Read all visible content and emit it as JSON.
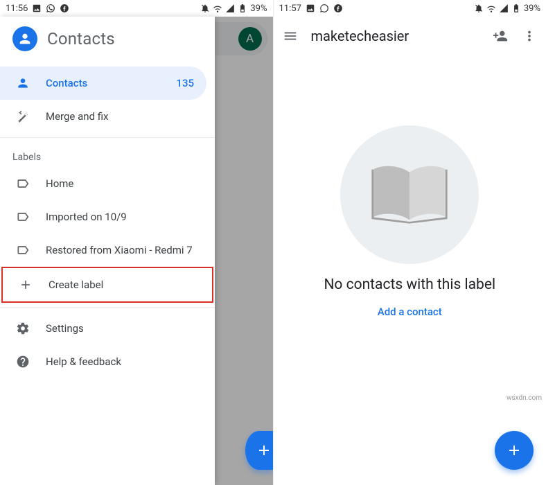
{
  "left": {
    "status": {
      "time": "11:56",
      "battery": "39%"
    },
    "drawer": {
      "title": "Contacts",
      "contacts_label": "Contacts",
      "contacts_count": "135",
      "merge_label": "Merge and fix",
      "labels_header": "Labels",
      "labels": [
        {
          "label": "Home"
        },
        {
          "label": "Imported on 10/9"
        },
        {
          "label": "Restored from Xiaomi - Redmi 7"
        }
      ],
      "create_label": "Create label",
      "settings_label": "Settings",
      "help_label": "Help & feedback"
    },
    "under_avatar": "A"
  },
  "right": {
    "status": {
      "time": "11:57",
      "battery": "39%"
    },
    "appbar": {
      "title": "maketecheasier"
    },
    "empty": {
      "title": "No contacts with this label",
      "action": "Add a contact"
    }
  },
  "watermark": "wsxdn.com"
}
